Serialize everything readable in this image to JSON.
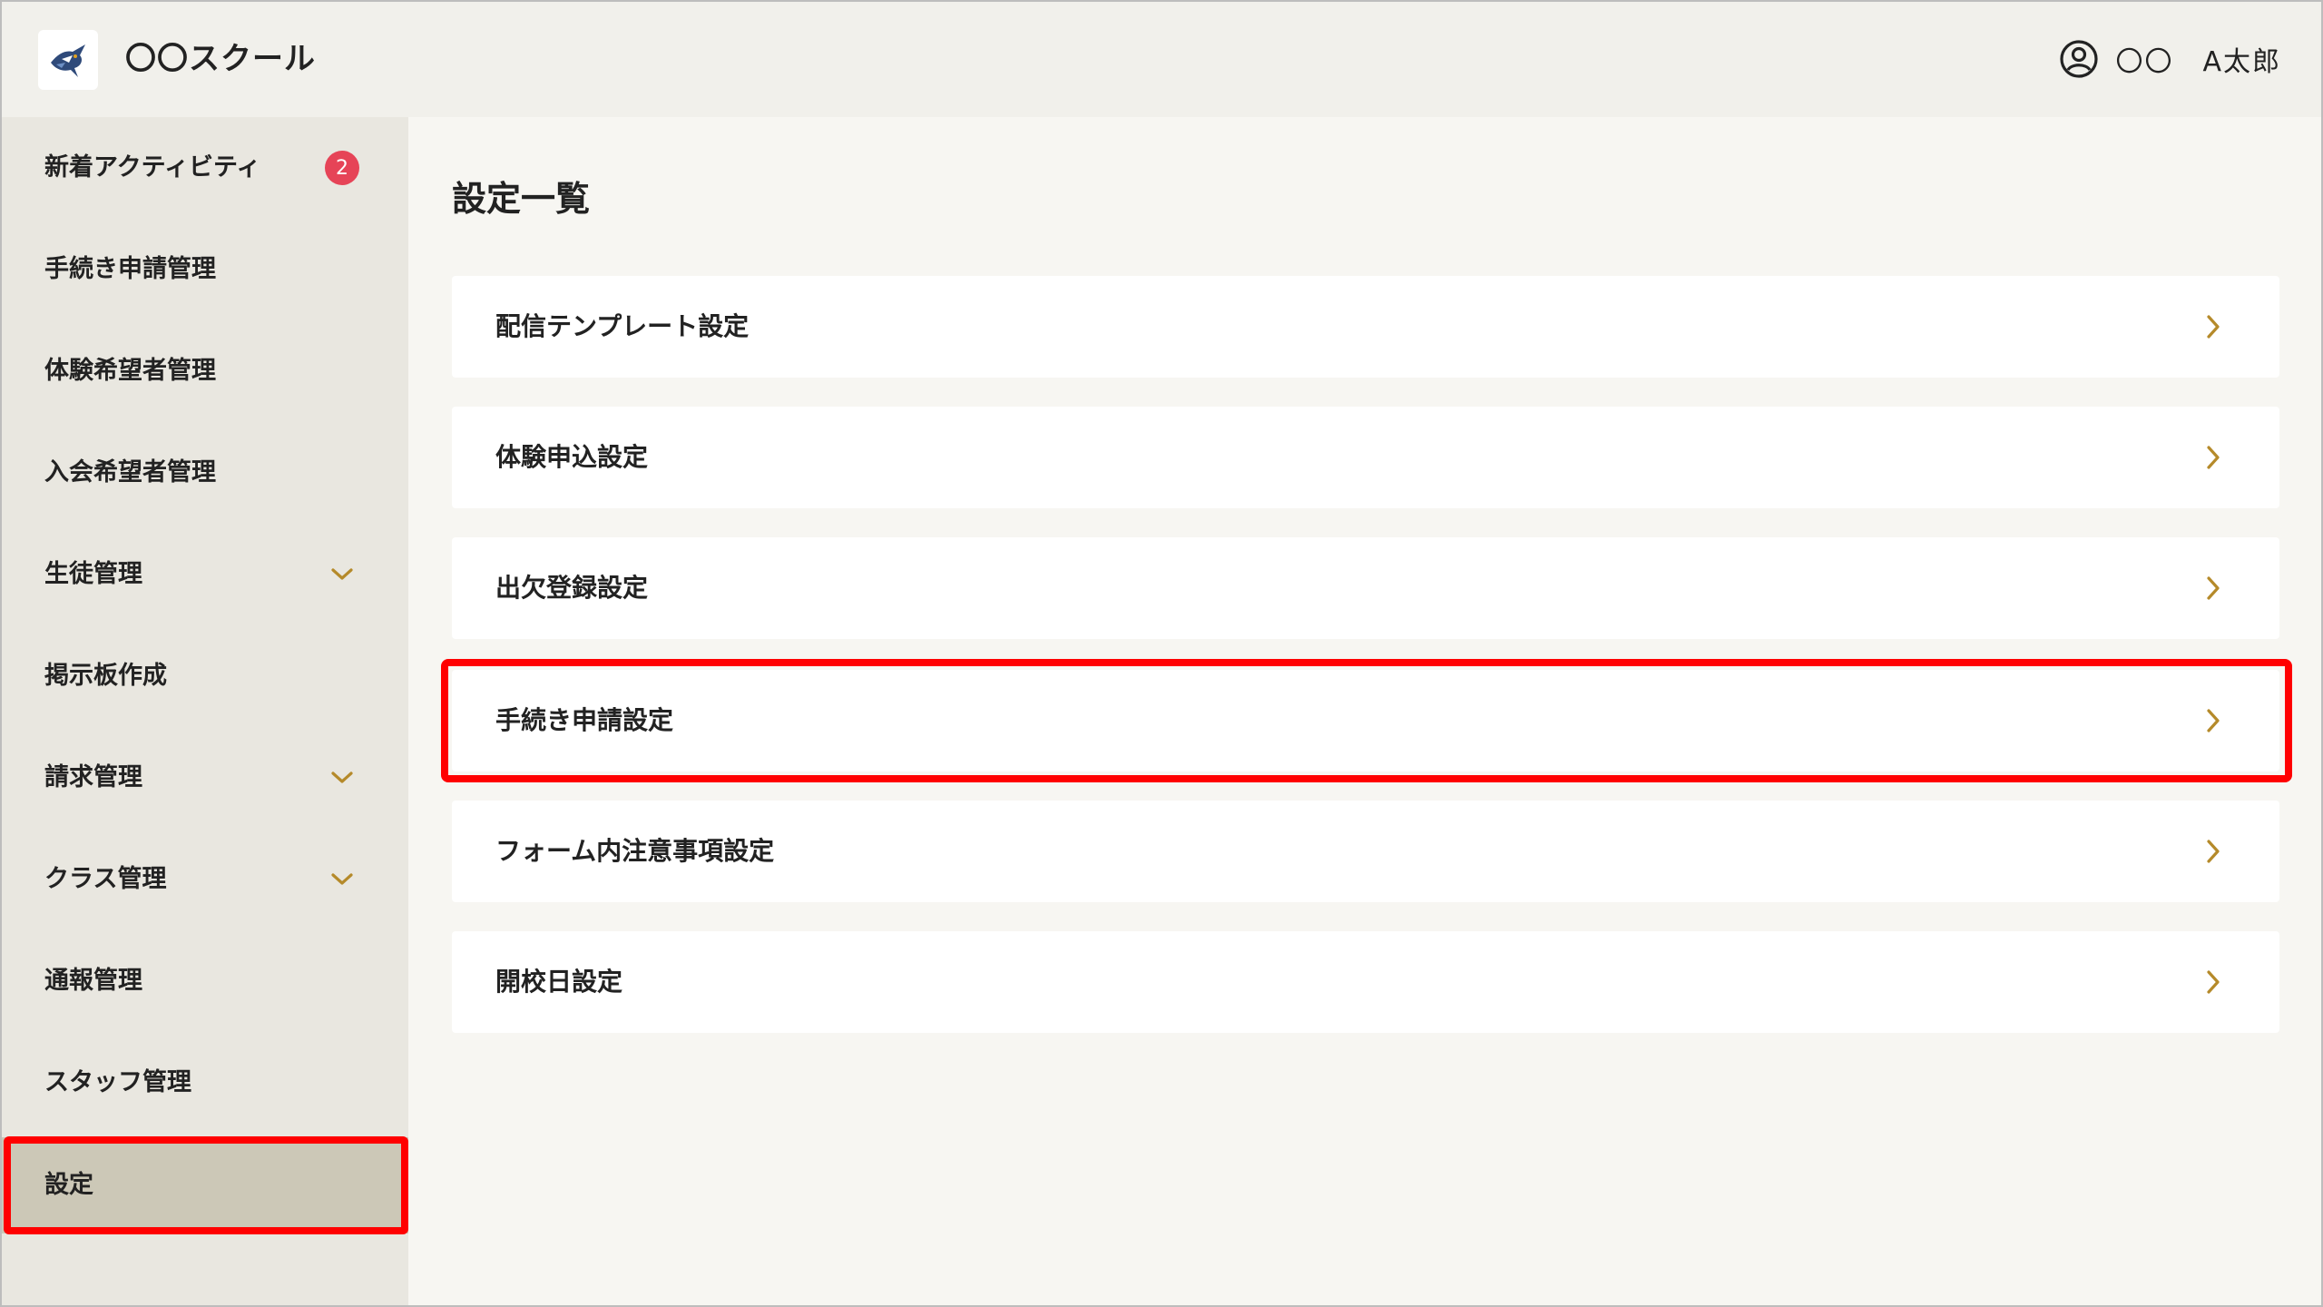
{
  "header": {
    "app_title": "〇〇スクール",
    "logo_icon": "bird-logo-icon",
    "user_icon": "user-circle-icon",
    "user_name": "〇〇　A太郎"
  },
  "sidebar": {
    "items": [
      {
        "label": "新着アクティビティ",
        "badge": "2"
      },
      {
        "label": "手続き申請管理"
      },
      {
        "label": "体験希望者管理"
      },
      {
        "label": "入会希望者管理"
      },
      {
        "label": "生徒管理",
        "icon": "chevron-down-icon"
      },
      {
        "label": "掲示板作成"
      },
      {
        "label": "請求管理",
        "icon": "chevron-down-icon"
      },
      {
        "label": "クラス管理",
        "icon": "chevron-down-icon"
      },
      {
        "label": "通報管理"
      },
      {
        "label": "スタッフ管理"
      },
      {
        "label": "設定",
        "active": true
      }
    ]
  },
  "main": {
    "title": "設定一覧",
    "rows": [
      {
        "label": "配信テンプレート設定",
        "icon": "chevron-right-icon"
      },
      {
        "label": "体験申込設定",
        "icon": "chevron-right-icon"
      },
      {
        "label": "出欠登録設定",
        "icon": "chevron-right-icon"
      },
      {
        "label": "手続き申請設定",
        "icon": "chevron-right-icon"
      },
      {
        "label": "フォーム内注意事項設定",
        "icon": "chevron-right-icon"
      },
      {
        "label": "開校日設定",
        "icon": "chevron-right-icon"
      }
    ]
  },
  "colors": {
    "accent_chevron": "#b58a2a",
    "badge": "#e64457",
    "highlight": "#ff0000",
    "sidebar_bg": "#e9e7e0",
    "sidebar_active": "#ccc8b7",
    "main_bg": "#f7f6f2"
  }
}
